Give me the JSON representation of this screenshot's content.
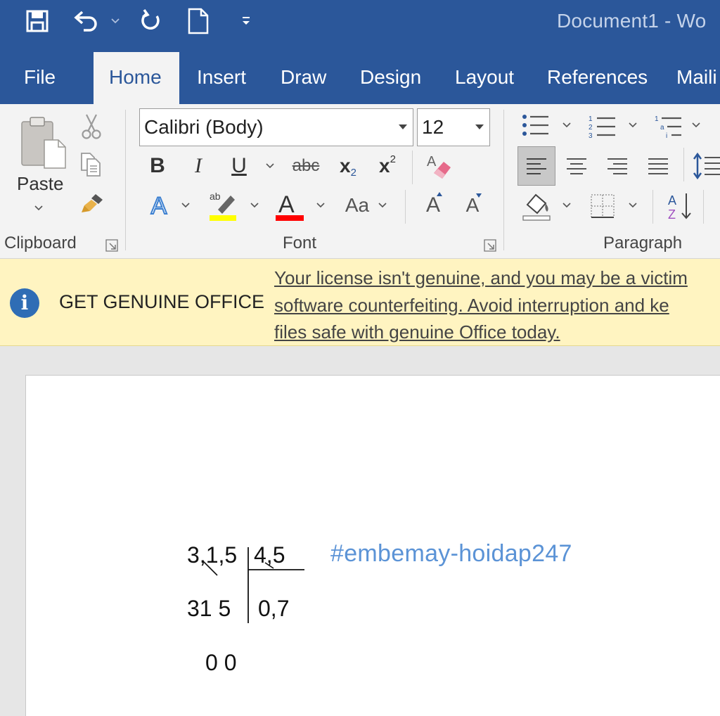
{
  "window": {
    "title": "Document1  -  Wo"
  },
  "quick_access": {
    "save_icon": "save-icon",
    "undo_icon": "undo-icon",
    "redo_icon": "redo-icon",
    "new_icon": "new-document-icon",
    "customize_icon": "customize-qat-icon"
  },
  "tabs": [
    {
      "label": "File"
    },
    {
      "label": "Home"
    },
    {
      "label": "Insert"
    },
    {
      "label": "Draw"
    },
    {
      "label": "Design"
    },
    {
      "label": "Layout"
    },
    {
      "label": "References"
    },
    {
      "label": "Maili"
    }
  ],
  "ribbon": {
    "clipboard": {
      "label": "Clipboard",
      "paste_label": "Paste"
    },
    "font": {
      "label": "Font",
      "font_name": "Calibri (Body)",
      "font_size": "12",
      "bold": "B",
      "italic": "I",
      "underline": "U",
      "strike": "abc",
      "subscript_base": "x",
      "subscript": "2",
      "superscript_base": "x",
      "superscript": "2",
      "change_case": "Aa",
      "grow": "A",
      "shrink": "A",
      "text_effects": "A",
      "font_color": "A",
      "highlight_color": "#ffff00",
      "font_color_value": "#ff0000"
    },
    "paragraph": {
      "label": "Paragraph"
    }
  },
  "banner": {
    "title": "GET GENUINE OFFICE",
    "message_lines": [
      "Your license isn't genuine, and you may be a victim",
      "software counterfeiting. Avoid interruption and ke",
      "files safe with genuine Office today."
    ]
  },
  "document": {
    "line1_left": "3,1,5",
    "line1_right": "4,5",
    "line2_left": "31  5",
    "line2_right": "0,7",
    "line3": "0 0",
    "watermark": "#embemay-hoidap247"
  },
  "colors": {
    "accent": "#2b579a",
    "banner_bg": "#fff4c1"
  }
}
